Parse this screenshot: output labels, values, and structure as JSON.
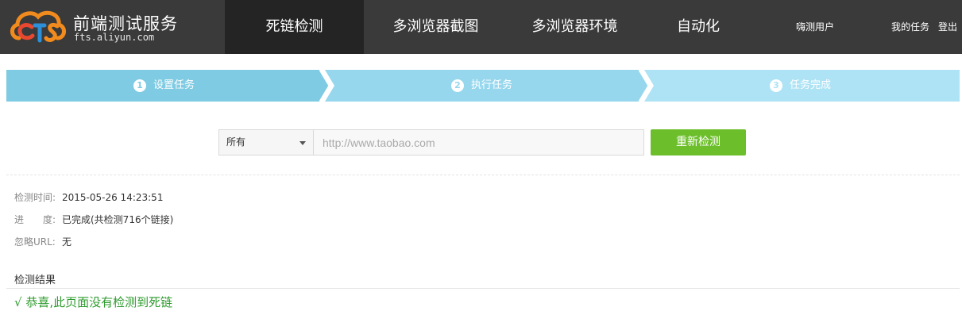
{
  "brand": {
    "title": "前端测试服务",
    "subtitle": "fts.aliyun.com",
    "logo_letters": "CTS",
    "colors": {
      "c": "#e8482f",
      "t": "#2d8fd8",
      "s": "#f28b1d"
    }
  },
  "nav": {
    "items": [
      {
        "label": "死链检测",
        "active": true
      },
      {
        "label": "多浏览器截图",
        "active": false
      },
      {
        "label": "多浏览器环境",
        "active": false
      },
      {
        "label": "自动化",
        "active": false
      }
    ],
    "user": "嗨测用户",
    "my_tasks": "我的任务",
    "logout": "登出"
  },
  "steps": [
    {
      "num": "1",
      "label": "设置任务",
      "color": "#7fcbe3"
    },
    {
      "num": "2",
      "label": "执行任务",
      "color": "#96d7ee"
    },
    {
      "num": "3",
      "label": "任务完成",
      "color": "#aee3f5"
    }
  ],
  "form": {
    "select_value": "所有",
    "url_placeholder": "http://www.taobao.com",
    "url_value": "",
    "button_label": "重新检测",
    "button_color": "#6cbf2a"
  },
  "info": {
    "time_label": "检测时间:",
    "time_value": "2015-05-26 14:23:51",
    "progress_label": "进　　度:",
    "progress_value": "已完成(共检测716个链接)",
    "ignore_label": "忽略URL:",
    "ignore_value": "无"
  },
  "result": {
    "title": "检测结果",
    "message": "√ 恭喜,此页面没有检测到死链",
    "message_color": "#2d9b2d"
  }
}
